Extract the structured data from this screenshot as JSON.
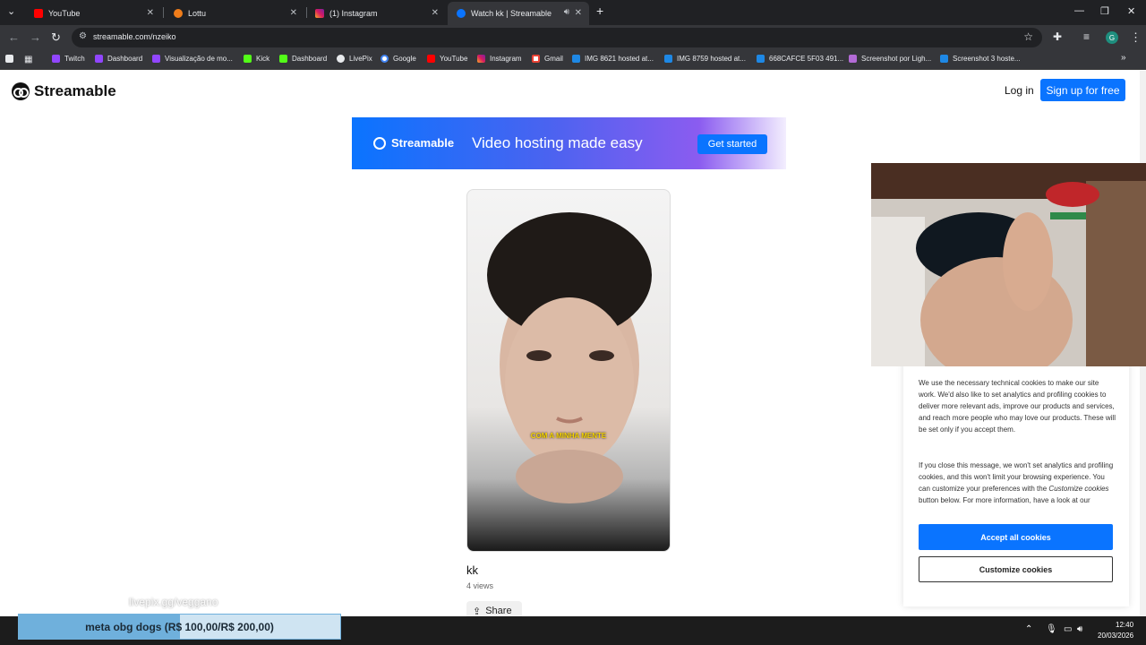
{
  "browser": {
    "tabs": [
      {
        "title": "YouTube",
        "icon": "youtube-icon"
      },
      {
        "title": "Lottu",
        "icon": "lottu-icon"
      },
      {
        "title": "(1) Instagram",
        "icon": "instagram-icon"
      },
      {
        "title": "Watch kk | Streamable",
        "icon": "streamable-icon",
        "active": true
      }
    ],
    "url": "streamable.com/nzeiko",
    "bookmarks": [
      "Twitch",
      "Dashboard",
      "Visualização de mo...",
      "Kick",
      "Dashboard",
      "LivePix",
      "Google",
      "YouTube",
      "Instagram",
      "Gmail",
      "IMG 8621 hosted at...",
      "IMG 8759 hosted at...",
      "668CAFCE 5F03 491...",
      "Screenshot por Ligh...",
      "Screenshot 3 hoste..."
    ],
    "profile_initial": "G"
  },
  "site": {
    "logo": "Streamable",
    "login": "Log in",
    "signup": "Sign up for free"
  },
  "banner": {
    "brand": "Streamable",
    "tagline": "Video hosting made easy",
    "cta": "Get started"
  },
  "video": {
    "caption": "COM A MINHA MENTE",
    "title": "kk",
    "views": "4 views",
    "share": "Share"
  },
  "cookie": {
    "para1": "We use the necessary technical cookies to make our site work. We'd also like to set analytics and profiling cookies to deliver more relevant ads, improve our products and services, and reach more people who may love our products. These will be set only if you accept them.",
    "para2a": "If you close this message, we won't set analytics and profiling cookies, and this won't limit your browsing experience. You can customize your preferences with the",
    "para2em": "Customize cookies",
    "para2b": "button below. For more information, have a look at our",
    "accept": "Accept all cookies",
    "customize": "Customize cookies"
  },
  "overlay": {
    "livepix": "livepix.gg/veggano",
    "meta": "meta obg dogs (R$ 100,00/R$ 200,00)",
    "meta_progress": 0.5
  },
  "taskbar": {
    "time": "12:40",
    "date": "20/03/2026"
  },
  "colors": {
    "accent": "#0a74ff"
  }
}
